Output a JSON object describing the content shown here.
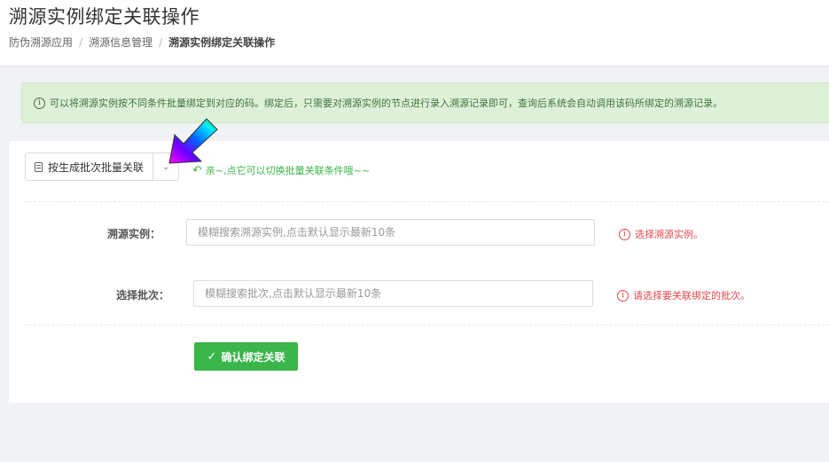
{
  "header": {
    "title": "溯源实例绑定关联操作",
    "breadcrumb": [
      "防伪溯源应用",
      "溯源信息管理",
      "溯源实例绑定关联操作"
    ],
    "separator": "/"
  },
  "alert": {
    "icon": "info-icon",
    "text": "可以将溯源实例按不同条件批量绑定到对应的码。绑定后，只需要对溯源实例的节点进行录入溯源记录即可，查询后系统会自动调用该码所绑定的溯源记录。"
  },
  "toolbar": {
    "mode_button_label": "按生成批次批量关联",
    "mode_button_icon": "document-icon",
    "caret_icon": "chevron-down-icon",
    "hint": "亲~,点它可以切换批量关联条件哦~~"
  },
  "form": {
    "instance": {
      "label": "溯源实例：",
      "value": "",
      "placeholder": "模糊搜索溯源实例,点击默认显示最新10条",
      "error": "选择溯源实例。"
    },
    "batch": {
      "label": "选择批次：",
      "value": "",
      "placeholder": "模糊搜索批次,点击默认显示最新10条",
      "error": "请选择要关联绑定的批次。"
    },
    "submit_label": "确认绑定关联"
  },
  "colors": {
    "accent_green": "#3ab54a",
    "alert_bg": "#dff0d8",
    "alert_text": "#3c763d",
    "error_red": "#e4484f"
  }
}
